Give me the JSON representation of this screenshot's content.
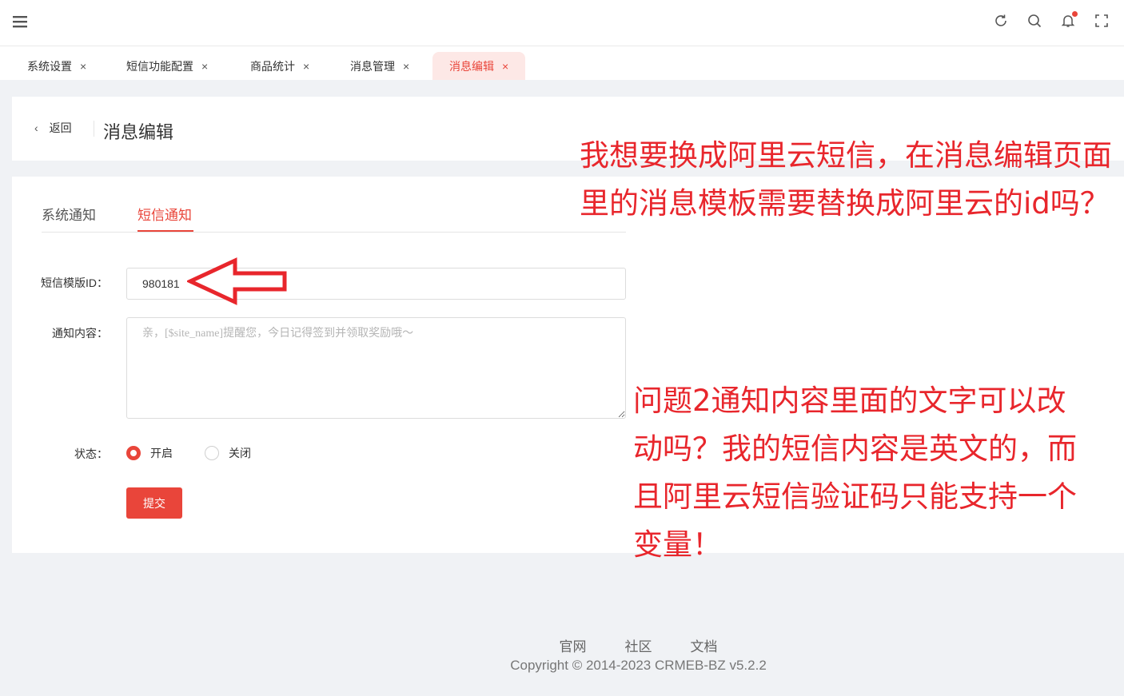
{
  "tabs": [
    {
      "label": "系统设置",
      "close": "×"
    },
    {
      "label": "短信功能配置",
      "close": "×"
    },
    {
      "label": "商品统计",
      "close": "×"
    },
    {
      "label": "消息管理",
      "close": "×"
    },
    {
      "label": "消息编辑",
      "close": "×",
      "active": true
    }
  ],
  "header": {
    "back_label": "返回",
    "back_chevron": "‹",
    "title": "消息编辑"
  },
  "sub_tabs": [
    "系统通知",
    "短信通知"
  ],
  "form": {
    "template_id_label": "短信模版ID：",
    "template_id_value": "980181",
    "content_label": "通知内容：",
    "content_placeholder": "亲，[$site_name]提醒您，今日记得签到并领取奖励哦～",
    "status_label": "状态：",
    "status_options": [
      "开启",
      "关闭"
    ],
    "status_selected": "开启",
    "submit_label": "提交"
  },
  "annotations": {
    "note1": "我想要换成阿里云短信，在消息编辑页面里的消息模板需要替换成阿里云的id吗？",
    "note2": "问题2通知内容里面的文字可以改动吗？我的短信内容是英文的，而且阿里云短信验证码只能支持一个变量！"
  },
  "footer": {
    "links": [
      "官网",
      "社区",
      "文档"
    ],
    "copyright": "Copyright © 2014-2023 CRMEB-BZ v5.2.2"
  },
  "colors": {
    "accent": "#e9453a",
    "annotation": "#e8262c"
  },
  "icons": [
    "menu-icon",
    "refresh-icon",
    "search-icon",
    "bell-icon",
    "fullscreen-icon",
    "close-icon",
    "chevron-left-icon",
    "arrow-left-icon"
  ]
}
